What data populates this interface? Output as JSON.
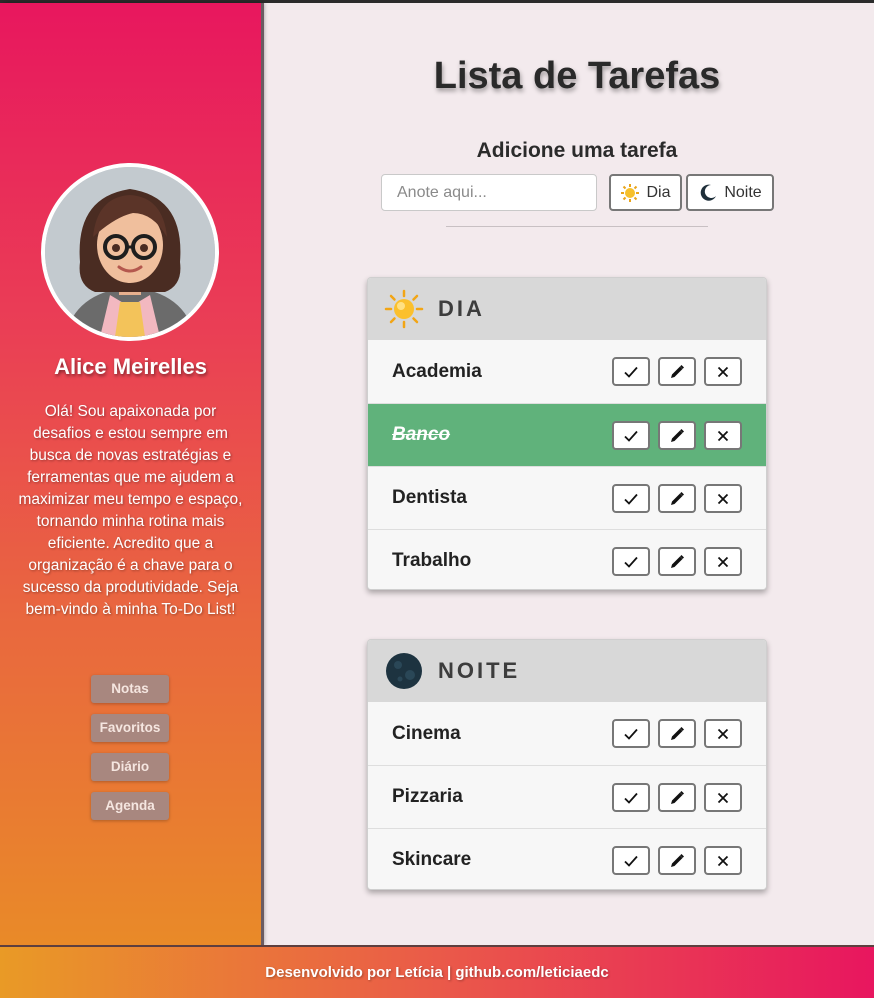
{
  "profile": {
    "name": "Alice Meirelles",
    "bio": "Olá! Sou apaixonada por desafios e estou sempre em busca de novas estratégias e ferramentas que me ajudem a maximizar meu tempo e espaço, tornando minha rotina mais eficiente. Acredito que a organização é a chave para o sucesso da produtividade. Seja bem-vindo à minha To-Do List!"
  },
  "nav": {
    "items": [
      {
        "label": "Notas"
      },
      {
        "label": "Favoritos"
      },
      {
        "label": "Diário"
      },
      {
        "label": "Agenda"
      }
    ]
  },
  "main": {
    "title": "Lista de Tarefas",
    "add_label": "Adicione uma tarefa",
    "input_placeholder": "Anote aqui...",
    "btn_day": "Dia",
    "btn_night": "Noite"
  },
  "day": {
    "title": "DIA",
    "tasks": [
      {
        "text": "Academia",
        "done": false
      },
      {
        "text": "Banco",
        "done": true
      },
      {
        "text": "Dentista",
        "done": false
      },
      {
        "text": "Trabalho",
        "done": false
      }
    ]
  },
  "night": {
    "title": "NOITE",
    "tasks": [
      {
        "text": "Cinema",
        "done": false
      },
      {
        "text": "Pizzaria",
        "done": false
      },
      {
        "text": "Skincare",
        "done": false
      }
    ]
  },
  "footer": {
    "text": "Desenvolvido por Letícia | github.com/leticiaedc"
  },
  "colors": {
    "done_row": "#60b27b",
    "sidebar_top": "#e8175e",
    "sidebar_bottom": "#e98a28",
    "nav_button": "#a8877f"
  },
  "icons": {
    "day": "sun-icon",
    "night": "moon-icon",
    "check": "check-icon",
    "edit": "pencil-icon",
    "delete": "close-icon"
  }
}
